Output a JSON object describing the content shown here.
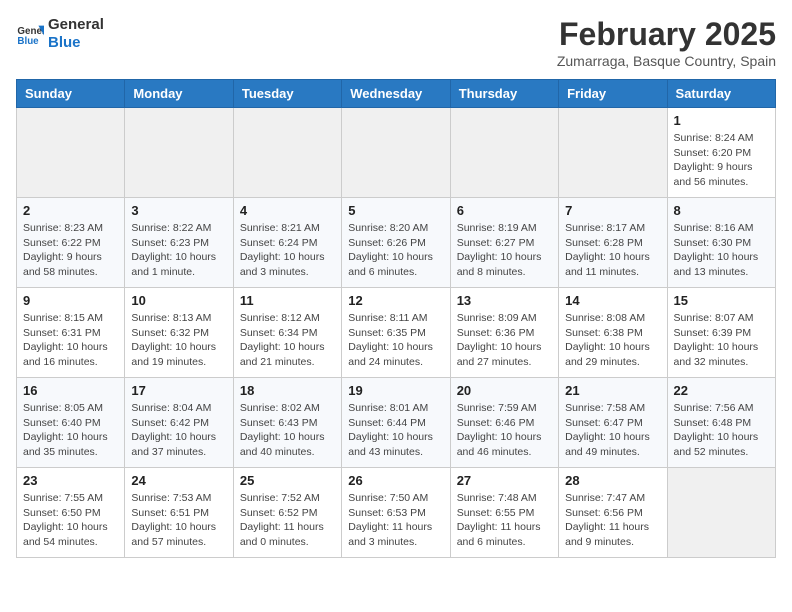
{
  "header": {
    "logo_line1": "General",
    "logo_line2": "Blue",
    "month_title": "February 2025",
    "location": "Zumarraga, Basque Country, Spain"
  },
  "weekdays": [
    "Sunday",
    "Monday",
    "Tuesday",
    "Wednesday",
    "Thursday",
    "Friday",
    "Saturday"
  ],
  "weeks": [
    [
      {
        "day": "",
        "info": ""
      },
      {
        "day": "",
        "info": ""
      },
      {
        "day": "",
        "info": ""
      },
      {
        "day": "",
        "info": ""
      },
      {
        "day": "",
        "info": ""
      },
      {
        "day": "",
        "info": ""
      },
      {
        "day": "1",
        "info": "Sunrise: 8:24 AM\nSunset: 6:20 PM\nDaylight: 9 hours and 56 minutes."
      }
    ],
    [
      {
        "day": "2",
        "info": "Sunrise: 8:23 AM\nSunset: 6:22 PM\nDaylight: 9 hours and 58 minutes."
      },
      {
        "day": "3",
        "info": "Sunrise: 8:22 AM\nSunset: 6:23 PM\nDaylight: 10 hours and 1 minute."
      },
      {
        "day": "4",
        "info": "Sunrise: 8:21 AM\nSunset: 6:24 PM\nDaylight: 10 hours and 3 minutes."
      },
      {
        "day": "5",
        "info": "Sunrise: 8:20 AM\nSunset: 6:26 PM\nDaylight: 10 hours and 6 minutes."
      },
      {
        "day": "6",
        "info": "Sunrise: 8:19 AM\nSunset: 6:27 PM\nDaylight: 10 hours and 8 minutes."
      },
      {
        "day": "7",
        "info": "Sunrise: 8:17 AM\nSunset: 6:28 PM\nDaylight: 10 hours and 11 minutes."
      },
      {
        "day": "8",
        "info": "Sunrise: 8:16 AM\nSunset: 6:30 PM\nDaylight: 10 hours and 13 minutes."
      }
    ],
    [
      {
        "day": "9",
        "info": "Sunrise: 8:15 AM\nSunset: 6:31 PM\nDaylight: 10 hours and 16 minutes."
      },
      {
        "day": "10",
        "info": "Sunrise: 8:13 AM\nSunset: 6:32 PM\nDaylight: 10 hours and 19 minutes."
      },
      {
        "day": "11",
        "info": "Sunrise: 8:12 AM\nSunset: 6:34 PM\nDaylight: 10 hours and 21 minutes."
      },
      {
        "day": "12",
        "info": "Sunrise: 8:11 AM\nSunset: 6:35 PM\nDaylight: 10 hours and 24 minutes."
      },
      {
        "day": "13",
        "info": "Sunrise: 8:09 AM\nSunset: 6:36 PM\nDaylight: 10 hours and 27 minutes."
      },
      {
        "day": "14",
        "info": "Sunrise: 8:08 AM\nSunset: 6:38 PM\nDaylight: 10 hours and 29 minutes."
      },
      {
        "day": "15",
        "info": "Sunrise: 8:07 AM\nSunset: 6:39 PM\nDaylight: 10 hours and 32 minutes."
      }
    ],
    [
      {
        "day": "16",
        "info": "Sunrise: 8:05 AM\nSunset: 6:40 PM\nDaylight: 10 hours and 35 minutes."
      },
      {
        "day": "17",
        "info": "Sunrise: 8:04 AM\nSunset: 6:42 PM\nDaylight: 10 hours and 37 minutes."
      },
      {
        "day": "18",
        "info": "Sunrise: 8:02 AM\nSunset: 6:43 PM\nDaylight: 10 hours and 40 minutes."
      },
      {
        "day": "19",
        "info": "Sunrise: 8:01 AM\nSunset: 6:44 PM\nDaylight: 10 hours and 43 minutes."
      },
      {
        "day": "20",
        "info": "Sunrise: 7:59 AM\nSunset: 6:46 PM\nDaylight: 10 hours and 46 minutes."
      },
      {
        "day": "21",
        "info": "Sunrise: 7:58 AM\nSunset: 6:47 PM\nDaylight: 10 hours and 49 minutes."
      },
      {
        "day": "22",
        "info": "Sunrise: 7:56 AM\nSunset: 6:48 PM\nDaylight: 10 hours and 52 minutes."
      }
    ],
    [
      {
        "day": "23",
        "info": "Sunrise: 7:55 AM\nSunset: 6:50 PM\nDaylight: 10 hours and 54 minutes."
      },
      {
        "day": "24",
        "info": "Sunrise: 7:53 AM\nSunset: 6:51 PM\nDaylight: 10 hours and 57 minutes."
      },
      {
        "day": "25",
        "info": "Sunrise: 7:52 AM\nSunset: 6:52 PM\nDaylight: 11 hours and 0 minutes."
      },
      {
        "day": "26",
        "info": "Sunrise: 7:50 AM\nSunset: 6:53 PM\nDaylight: 11 hours and 3 minutes."
      },
      {
        "day": "27",
        "info": "Sunrise: 7:48 AM\nSunset: 6:55 PM\nDaylight: 11 hours and 6 minutes."
      },
      {
        "day": "28",
        "info": "Sunrise: 7:47 AM\nSunset: 6:56 PM\nDaylight: 11 hours and 9 minutes."
      },
      {
        "day": "",
        "info": ""
      }
    ]
  ]
}
